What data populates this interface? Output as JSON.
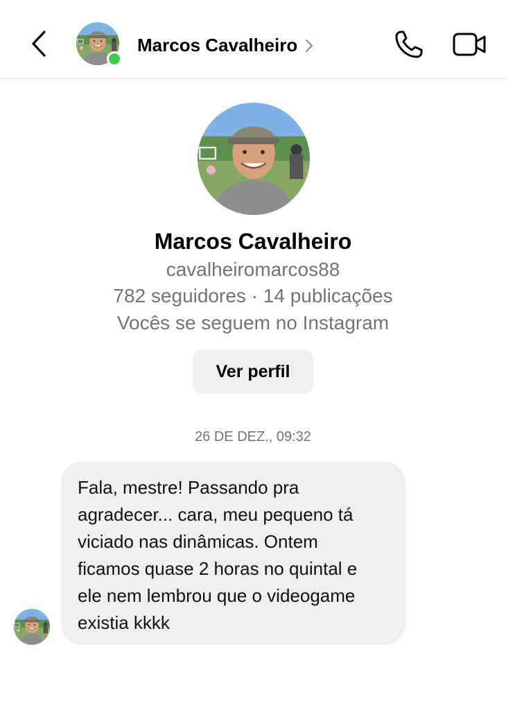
{
  "header": {
    "contact_name": "Marcos Cavalheiro"
  },
  "profile": {
    "name": "Marcos Cavalheiro",
    "username": "cavalheiromarcos88",
    "stats": "782 seguidores · 14 publicações",
    "mutual": "Vocês se seguem no Instagram",
    "view_profile_label": "Ver perfil"
  },
  "thread": {
    "timestamp": "26 DE DEZ., 09:32",
    "messages": [
      {
        "text_lines": [
          "Fala, mestre! Passando pra",
          "agradecer... cara, meu pequeno tá",
          "viciado nas dinâmicas. Ontem",
          "ficamos quase 2 horas no quintal e",
          "ele nem lembrou que o videogame",
          "existia kkkk"
        ]
      }
    ]
  },
  "colors": {
    "online": "#3fcd4e",
    "bubble": "#efefef",
    "secondary_text": "#737373"
  },
  "icons": [
    "back-arrow-icon",
    "chevron-right-icon",
    "phone-icon",
    "video-camera-icon"
  ]
}
